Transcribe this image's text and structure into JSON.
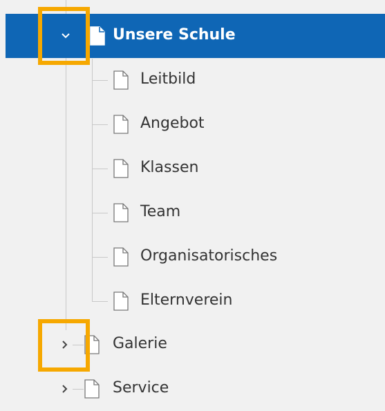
{
  "colors": {
    "selected_bg": "#0f66b5",
    "highlight": "#f6a800",
    "tree_line": "#c8c8c8",
    "background": "#f1f1f1"
  },
  "tree": {
    "expanded_item": {
      "label": "Unsere Schule",
      "toggle_icon": "chevron-down-icon",
      "children": [
        {
          "label": "Leitbild"
        },
        {
          "label": "Angebot"
        },
        {
          "label": "Klassen"
        },
        {
          "label": "Team"
        },
        {
          "label": "Organisatorisches"
        },
        {
          "label": "Elternverein"
        }
      ]
    },
    "collapsed_items": [
      {
        "label": "Galerie",
        "toggle_icon": "chevron-right-icon"
      },
      {
        "label": "Service",
        "toggle_icon": "chevron-right-icon"
      }
    ]
  }
}
